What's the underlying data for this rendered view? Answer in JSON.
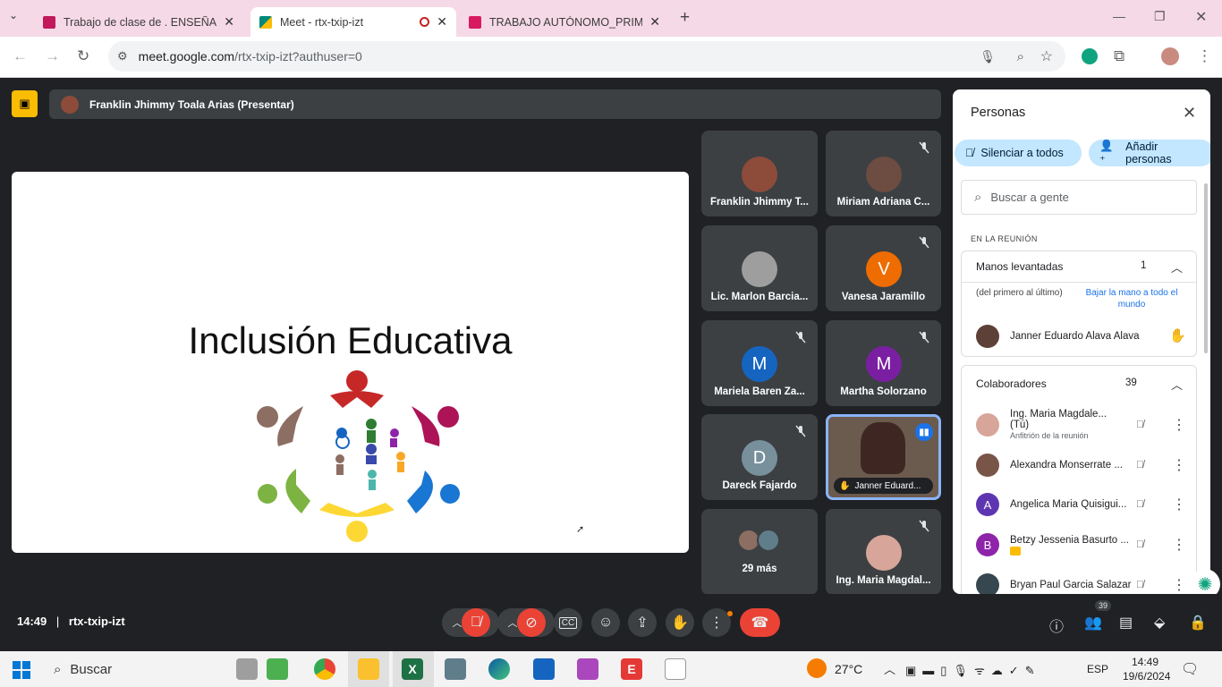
{
  "browser": {
    "tabs": [
      {
        "title": "Trabajo de clase de . ENSEÑANZ",
        "color": "#e91e63"
      },
      {
        "title": "Meet - rtx-txip-izt",
        "color": "#00897b"
      },
      {
        "title": "TRABAJO AUTÓNOMO_PRIMER",
        "color": "#e91e63"
      }
    ],
    "url_host": "meet.google.com",
    "url_path": "/rtx-txip-izt?authuser=0"
  },
  "meet": {
    "presenter_label": "Franklin Jhimmy Toala Arias (Presentar)",
    "slide_title": "Inclusión Educativa",
    "tiles": [
      {
        "name": "Franklin Jhimmy T...",
        "avatar_letter": "",
        "avatar_color": "#8d4b3a",
        "muted": false
      },
      {
        "name": "Miriam Adriana C...",
        "avatar_letter": "",
        "avatar_color": "#6d4c41",
        "muted": true
      },
      {
        "name": "Lic. Marlon Barcia...",
        "avatar_letter": "",
        "avatar_color": "#9e9e9e",
        "muted": false
      },
      {
        "name": "Vanesa Jaramillo",
        "avatar_letter": "V",
        "avatar_color": "#ef6c00",
        "muted": true
      },
      {
        "name": "Mariela Baren Za...",
        "avatar_letter": "M",
        "avatar_color": "#1565c0",
        "muted": true
      },
      {
        "name": "Martha Solorzano",
        "avatar_letter": "M",
        "avatar_color": "#7b1fa2",
        "muted": true
      },
      {
        "name": "Dareck Fajardo",
        "avatar_letter": "D",
        "avatar_color": "#78909c",
        "muted": true
      },
      {
        "name": "Janner Eduard...",
        "avatar_letter": "",
        "avatar_color": "#5d4037",
        "muted": false
      },
      {
        "name": "29 más",
        "avatar_letter": "",
        "avatar_color": "#8d6e63",
        "muted": false
      },
      {
        "name": "Ing. Maria Magdal...",
        "avatar_letter": "",
        "avatar_color": "#d7a59a",
        "muted": true
      }
    ],
    "meeting_time": "14:49",
    "meeting_code": "rtx-txip-izt",
    "participant_count": "39"
  },
  "people": {
    "title": "Personas",
    "mute_all": "Silenciar a todos",
    "add_people": "Añadir personas",
    "search_placeholder": "Buscar a gente",
    "in_meeting": "EN LA REUNIÓN",
    "raised_hands_label": "Manos levantadas",
    "raised_hands_count": "1",
    "order_note": "(del primero al último)",
    "lower_all": "Bajar la mano a todo el mundo",
    "raised_person": "Janner Eduardo Alava Alava",
    "collaborators_label": "Colaboradores",
    "collaborators_count": "39",
    "people_list": [
      {
        "name": "Ing. Maria Magdale...",
        "tag": "(Tú)",
        "sub": "Anfitrión de la reunión",
        "letter": "",
        "color": "#d7a59a"
      },
      {
        "name": "Alexandra Monserrate ...",
        "tag": "",
        "sub": "",
        "letter": "",
        "color": "#795548"
      },
      {
        "name": "Angelica Maria Quisigui...",
        "tag": "",
        "sub": "",
        "letter": "A",
        "color": "#5e35b1"
      },
      {
        "name": "Betzy Jessenia Basurto ...",
        "tag": "",
        "sub": "",
        "letter": "B",
        "color": "#8e24aa"
      },
      {
        "name": "Bryan Paul Garcia Salazar",
        "tag": "",
        "sub": "",
        "letter": "",
        "color": "#37474f"
      }
    ]
  },
  "taskbar": {
    "search_label": "Buscar",
    "weather": "27°C",
    "lang": "ESP",
    "clock_time": "14:49",
    "clock_date": "19/6/2024"
  }
}
